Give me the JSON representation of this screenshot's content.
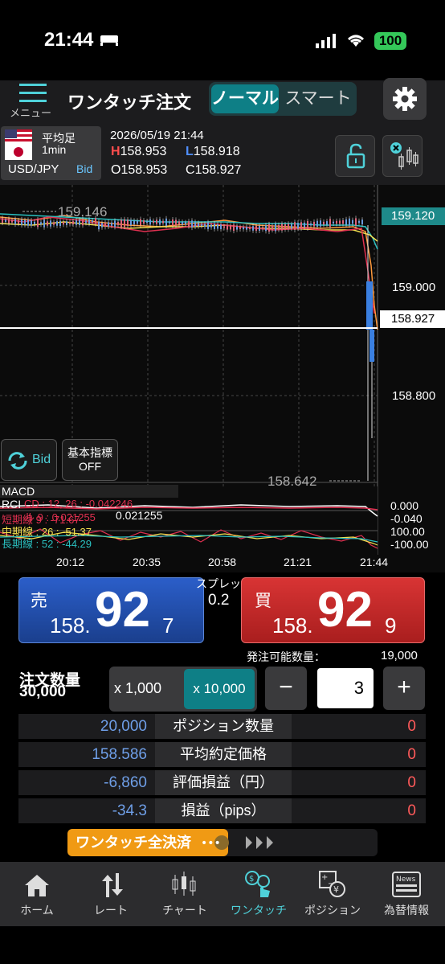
{
  "status": {
    "time": "21:44",
    "battery": "100"
  },
  "header": {
    "menu_label": "メニュー",
    "title": "ワンタッチ注文",
    "mode_normal": "ノーマル",
    "mode_smart": "スマート"
  },
  "instrument": {
    "bar_type": "平均足",
    "period": "1min",
    "pair": "USD/JPY",
    "side": "Bid",
    "datetime": "2026/05/19 21:44",
    "high_tag": "H",
    "high": "158.953",
    "low_tag": "L",
    "low": "158.918",
    "open_tag": "O",
    "open": "158.953",
    "close_tag": "C",
    "close": "158.927"
  },
  "chart": {
    "max_label": "159.146",
    "min_label": "158.642",
    "axis_labels": [
      "159.000",
      "158.800"
    ],
    "top_price_label": "159.120",
    "current_price_label": "158.927",
    "bid_button": "Bid",
    "indicator_button_line1": "基本指標",
    "indicator_button_line2": "OFF",
    "sub_labels": [
      "MACD",
      "RCI"
    ],
    "macd_overlay": "CD : 12, 26 : -0.042246",
    "signal_overlay": "ル 9 : 0.021255",
    "rci_short": "短期線 9 : -71.67",
    "rci_mid": "中期線 : 26 : -51.37",
    "rci_long": "長期線 : 52 : -44.29",
    "right_axis_sub": [
      "0.000",
      "-0.040",
      "100.00",
      "-100.00"
    ],
    "time_labels": [
      "20:12",
      "20:35",
      "20:58",
      "21:21",
      "21:44"
    ]
  },
  "order": {
    "sell_label": "売",
    "sell_big": "158.",
    "sell_pips": "92",
    "sell_small": "7",
    "spread_label": "スプレッド",
    "spread_value": "0.2",
    "buy_label": "買",
    "buy_big": "158.",
    "buy_pips": "92",
    "buy_small": "9",
    "available_label": "発注可能数量：",
    "available_value": "19,000",
    "qty_label": "注文数量",
    "qty_value": "30,000",
    "mult_1": "x 1,000",
    "mult_2": "x 10,000",
    "minus": "−",
    "plus": "+",
    "qty_input": "3"
  },
  "positions": [
    {
      "value": "20,000",
      "label": "ポジション数量",
      "right": "0"
    },
    {
      "value": "158.586",
      "label": "平均約定価格",
      "right": "0"
    },
    {
      "value": "-6,860",
      "label": "評価損益（円）",
      "right": "0"
    },
    {
      "value": "-34.3",
      "label": "損益（pips）",
      "right": "0"
    }
  ],
  "close_all": "ワンタッチ全決済",
  "tabs": [
    {
      "label": "ホーム",
      "icon": "home-icon"
    },
    {
      "label": "レート",
      "icon": "rate-arrows-icon"
    },
    {
      "label": "チャート",
      "icon": "candlestick-icon"
    },
    {
      "label": "ワンタッチ",
      "icon": "one-touch-icon"
    },
    {
      "label": "ポジション",
      "icon": "position-icon"
    },
    {
      "label": "為替情報",
      "icon": "news-icon"
    }
  ],
  "colors": {
    "accent": "#0e7f86",
    "sell": "#2b5ec9",
    "buy": "#d83434",
    "teal_label": "#1e8a8a"
  }
}
